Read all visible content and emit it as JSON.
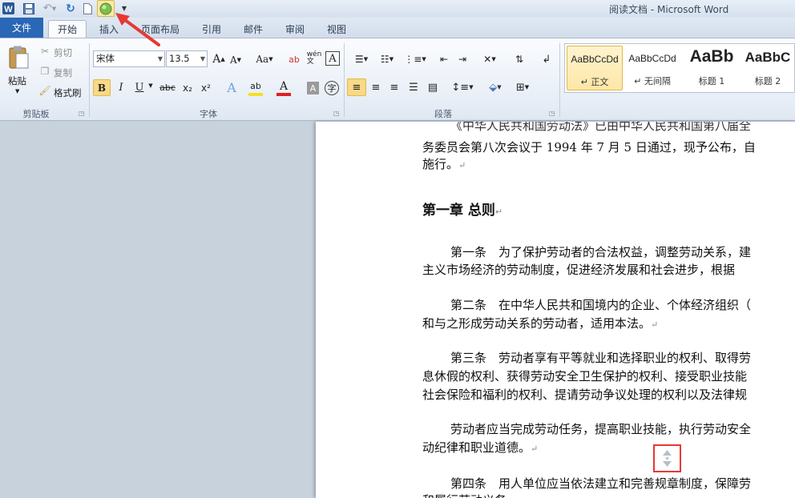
{
  "window": {
    "title": "阅读文档 - Microsoft Word"
  },
  "quick_access": {
    "icons": [
      "word-logo-icon",
      "save-icon",
      "undo-icon",
      "redo-icon",
      "new-doc-icon",
      "green-circle-icon",
      "customize-dropdown-icon"
    ]
  },
  "tabs": [
    "文件",
    "开始",
    "插入",
    "页面布局",
    "引用",
    "邮件",
    "审阅",
    "视图"
  ],
  "active_tab": "开始",
  "ribbon": {
    "clipboard": {
      "paste": "粘贴",
      "cut": "剪切",
      "copy": "复制",
      "format_painter": "格式刷",
      "label": "剪贴板"
    },
    "font": {
      "name": "宋体",
      "size": "13.5",
      "grow": "A",
      "shrink": "A",
      "case": "Aa",
      "label": "字体",
      "bold": "B",
      "italic": "I",
      "underline": "U",
      "strike": "abc",
      "subscript": "x₂",
      "superscript": "x²"
    },
    "paragraph": {
      "label": "段落"
    },
    "styles": [
      {
        "sample": "AaBbCcDd",
        "name": "↵ 正文"
      },
      {
        "sample": "AaBbCcDd",
        "name": "↵ 无间隔"
      },
      {
        "sample": "AaBb",
        "name": "标题 1"
      },
      {
        "sample": "AaBbC",
        "name": "标题 2"
      }
    ]
  },
  "document": {
    "lines": [
      "《中华人民共和国劳动法》已由中华人民共和国第八届全",
      "务委员会第八次会议于 1994 年 7 月 5 日通过，现予公布，自",
      "施行。"
    ],
    "heading": "第一章 总则",
    "art1": [
      "第一条　为了保护劳动者的合法权益，调整劳动关系，建",
      "主义市场经济的劳动制度，促进经济发展和社会进步，根据"
    ],
    "art2": [
      "第二条　在中华人民共和国境内的企业、个体经济组织（",
      "和与之形成劳动关系的劳动者，适用本法。"
    ],
    "art3": [
      "第三条　劳动者享有平等就业和选择职业的权利、取得劳",
      "息休假的权利、获得劳动安全卫生保护的权利、接受职业技能",
      "社会保险和福利的权利、提请劳动争议处理的权利以及法律规"
    ],
    "para4": [
      "劳动者应当完成劳动任务，提高职业技能，执行劳动安全",
      "动纪律和职业道德。"
    ],
    "art4": [
      "第四条　用人单位应当依法建立和完善规章制度，保障劳",
      "和履行劳动义务。"
    ],
    "para_mark": "↵"
  },
  "colors": {
    "file_tab": "#2a67b6",
    "highlight_box": "#e53935",
    "annotation_arrow": "#e53935"
  }
}
